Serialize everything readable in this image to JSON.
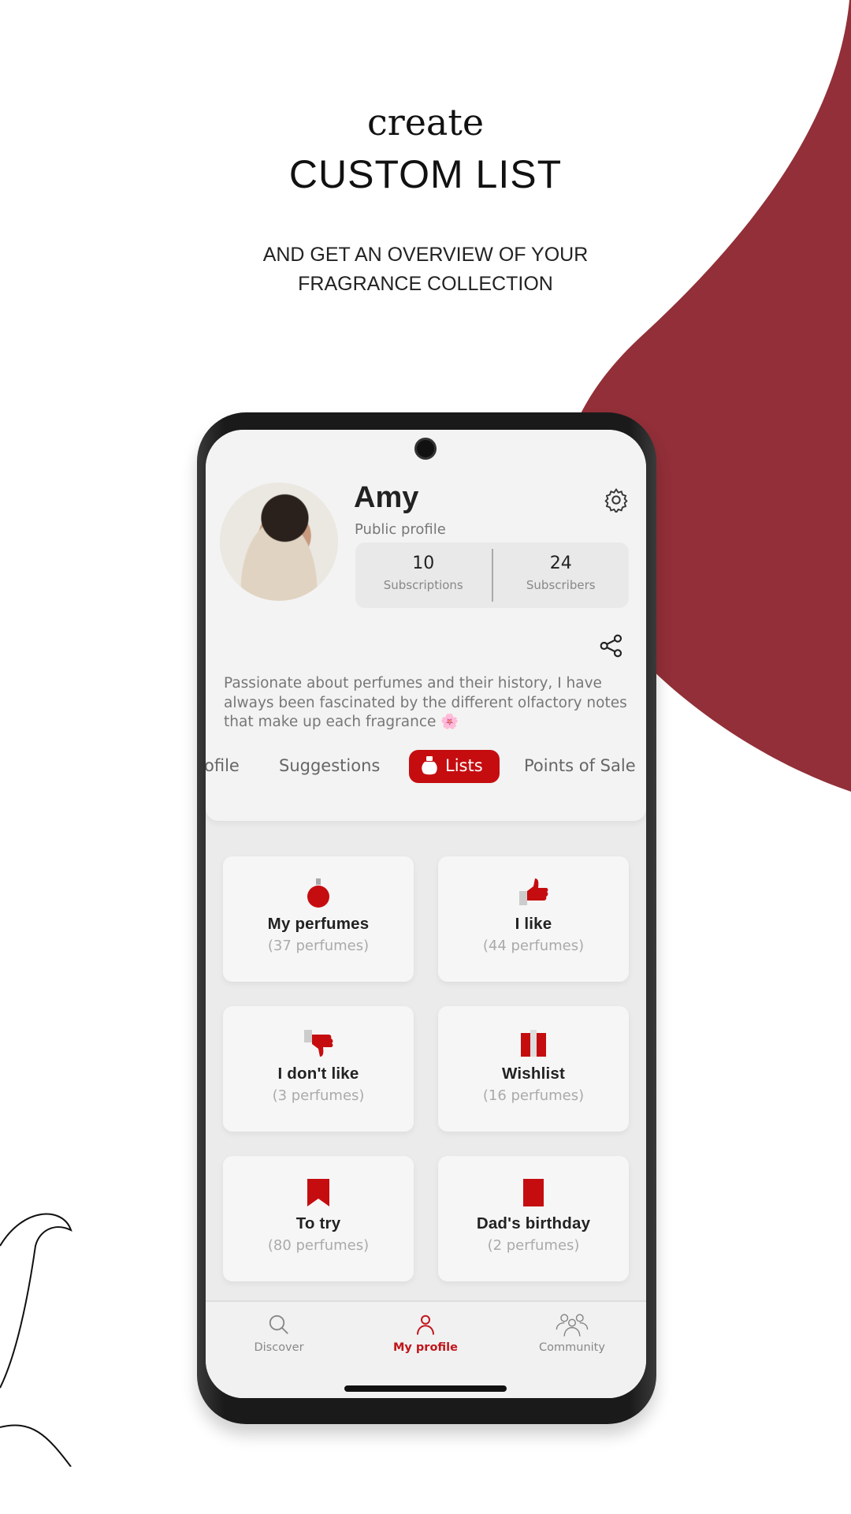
{
  "headline": {
    "script": "create",
    "title": "CUSTOM LIST",
    "subtitle_line1": "AND GET AN OVERVIEW OF YOUR",
    "subtitle_line2": "FRAGRANCE COLLECTION"
  },
  "colors": {
    "accent": "#c50d10",
    "blob": "#922f38"
  },
  "profile": {
    "name": "Amy",
    "visibility": "Public profile",
    "subscriptions_count": "10",
    "subscriptions_label": "Subscriptions",
    "subscribers_count": "24",
    "subscribers_label": "Subscribers",
    "bio": "Passionate about perfumes and their history, I have always been fascinated by the different olfactory notes that make up each fragrance 🌸"
  },
  "tabs": [
    {
      "label": "ofile"
    },
    {
      "label": "Suggestions"
    },
    {
      "label": "Lists",
      "active": true,
      "icon": "perfume-bottle-icon"
    },
    {
      "label": "Points of Sale"
    }
  ],
  "lists": [
    {
      "title": "My perfumes",
      "count": "(37 perfumes)",
      "icon": "perfume-bottle-icon"
    },
    {
      "title": "I like",
      "count": "(44 perfumes)",
      "icon": "thumbs-up-icon"
    },
    {
      "title": "I don't like",
      "count": "(3 perfumes)",
      "icon": "thumbs-down-icon"
    },
    {
      "title": "Wishlist",
      "count": "(16 perfumes)",
      "icon": "gift-icon"
    },
    {
      "title": "To try",
      "count": "(80 perfumes)",
      "icon": "bookmark-icon"
    },
    {
      "title": "Dad's birthday",
      "count": "(2 perfumes)",
      "icon": "list-book-icon"
    }
  ],
  "nav": [
    {
      "label": "Discover",
      "icon": "search-icon"
    },
    {
      "label": "My profile",
      "icon": "user-icon",
      "active": true
    },
    {
      "label": "Community",
      "icon": "community-icon"
    }
  ]
}
